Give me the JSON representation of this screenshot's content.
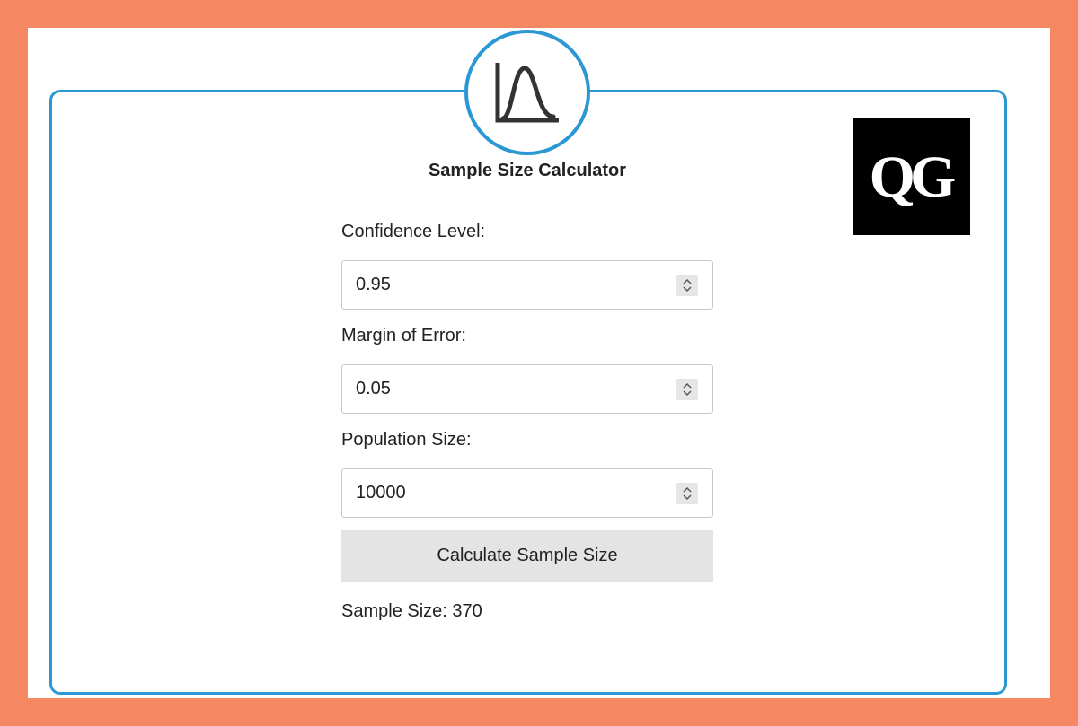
{
  "app": {
    "title": "Sample Size Calculator",
    "logo_text": "QG",
    "colors": {
      "frame": "#F58762",
      "accent": "#2B98D4",
      "button_bg": "#E4E4E4"
    },
    "header_icon": "bell-curve-icon"
  },
  "form": {
    "confidence": {
      "label": "Confidence Level:",
      "value": "0.95"
    },
    "margin": {
      "label": "Margin of Error:",
      "value": "0.05"
    },
    "population": {
      "label": "Population Size:",
      "value": "10000"
    },
    "calculate_label": "Calculate Sample Size"
  },
  "result": {
    "prefix": "Sample Size:",
    "value": "370"
  }
}
